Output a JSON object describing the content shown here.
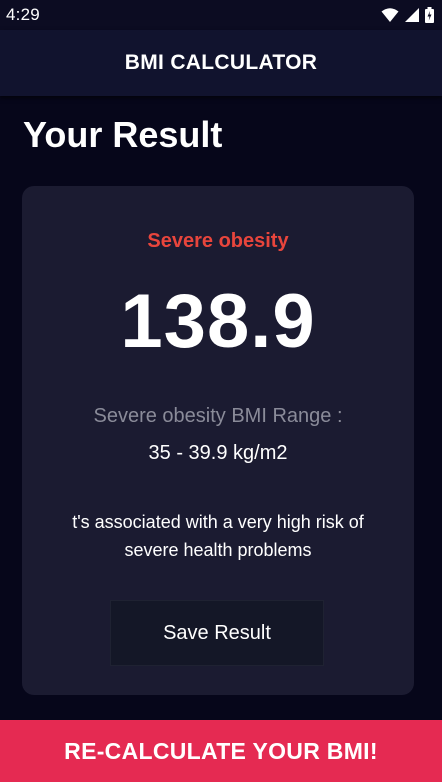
{
  "status_bar": {
    "time": "4:29",
    "icons": [
      "wifi-icon",
      "signal-icon",
      "battery-icon"
    ]
  },
  "app_bar": {
    "title": "BMI CALCULATOR"
  },
  "result": {
    "heading": "Your Result",
    "category": "Severe obesity",
    "bmi": "138.9",
    "range_label": "Severe obesity BMI Range :",
    "range_value": "35 - 39.9 kg/m2",
    "interpretation": "t's associated with a very high risk of severe health problems",
    "save_label": "Save Result"
  },
  "bottom_action": {
    "label": "RE-CALCULATE YOUR BMI!"
  },
  "colors": {
    "background": "#06061a",
    "app_bar": "#11132e",
    "card": "#1b1b31",
    "category": "#e8453c",
    "accent": "#e52a52",
    "muted_text": "#8a8b99"
  }
}
